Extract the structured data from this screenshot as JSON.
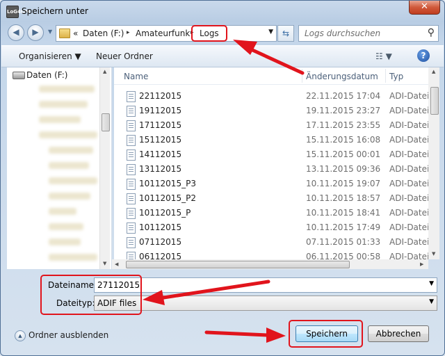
{
  "window": {
    "title": "Speichern unter",
    "app_icon_text": "LoG4OM",
    "close_label": "✕"
  },
  "nav": {
    "back_icon": "back-arrow-icon",
    "forward_icon": "forward-arrow-icon",
    "breadcrumb": {
      "prefix": "«",
      "items": [
        "Daten (F:)",
        "Amateurfunk",
        "Logs"
      ],
      "separator": "▸"
    },
    "refresh_icon": "refresh-icon",
    "search_placeholder": "Logs durchsuchen"
  },
  "toolbar": {
    "organize_label": "Organisieren ▼",
    "new_folder_label": "Neuer Ordner",
    "view_icon": "view-options-icon",
    "help_label": "?"
  },
  "tree": {
    "root_label": "Daten (F:)"
  },
  "list": {
    "columns": {
      "name": "Name",
      "date": "Änderungsdatum",
      "type": "Typ"
    },
    "rows": [
      {
        "name": "22112015",
        "date": "22.11.2015 17:04",
        "type": "ADI-Datei"
      },
      {
        "name": "19112015",
        "date": "19.11.2015 23:27",
        "type": "ADI-Datei"
      },
      {
        "name": "17112015",
        "date": "17.11.2015 23:55",
        "type": "ADI-Datei"
      },
      {
        "name": "15112015",
        "date": "15.11.2015 16:08",
        "type": "ADI-Datei"
      },
      {
        "name": "14112015",
        "date": "15.11.2015 00:01",
        "type": "ADI-Datei"
      },
      {
        "name": "13112015",
        "date": "13.11.2015 09:36",
        "type": "ADI-Datei"
      },
      {
        "name": "10112015_P3",
        "date": "10.11.2015 19:07",
        "type": "ADI-Datei"
      },
      {
        "name": "10112015_P2",
        "date": "10.11.2015 18:57",
        "type": "ADI-Datei"
      },
      {
        "name": "10112015_P",
        "date": "10.11.2015 18:41",
        "type": "ADI-Datei"
      },
      {
        "name": "10112015",
        "date": "10.11.2015 17:49",
        "type": "ADI-Datei"
      },
      {
        "name": "07112015",
        "date": "07.11.2015 01:33",
        "type": "ADI-Datei"
      },
      {
        "name": "06112015",
        "date": "06.11.2015 00:58",
        "type": "ADI-Datei"
      }
    ]
  },
  "form": {
    "filename_label": "Dateiname:",
    "filename_value": "27112015",
    "filetype_label": "Dateityp:",
    "filetype_value": "ADIF files"
  },
  "footer": {
    "hide_folders_label": "Ordner ausblenden",
    "save_label": "Speichern",
    "cancel_label": "Abbrechen"
  },
  "colors": {
    "annotation_red": "#e1141c",
    "accent_blue": "#3c7fb1"
  }
}
